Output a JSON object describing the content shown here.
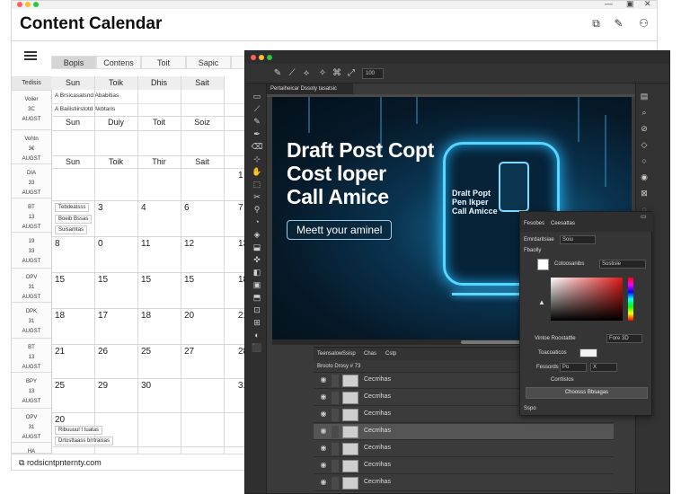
{
  "calendar_window": {
    "title": "Content Calendar",
    "tabs": [
      {
        "label": "Bopis"
      },
      {
        "label": "Contens"
      },
      {
        "label": "Toit"
      },
      {
        "label": "Sapic"
      }
    ],
    "sidebar_header": "Tedisis",
    "sidebar_cells": [
      {
        "line1": "Voiier",
        "line2": "3C",
        "line3": "AUGST"
      },
      {
        "line1": "Vohtn",
        "line2": "3€",
        "line3": "AUGST"
      },
      {
        "line1": "DIA",
        "line2": "33",
        "line3": "AUGST"
      },
      {
        "line1": "BT",
        "line2": "13",
        "line3": "AUGST"
      },
      {
        "line1": "19",
        "line2": "33",
        "line3": "AUGST"
      },
      {
        "line1": "OPV",
        "line2": "31",
        "line3": "AUGST"
      },
      {
        "line1": "DPK",
        "line2": "31",
        "line3": "AUGST"
      },
      {
        "line1": "BT",
        "line2": "13",
        "line3": "AUGST"
      },
      {
        "line1": "BPY",
        "line2": "13",
        "line3": "AUGST"
      },
      {
        "line1": "OPV",
        "line2": "31",
        "line3": "AUGST"
      },
      {
        "line1": "HA",
        "line2": "",
        "line3": ""
      }
    ],
    "day_headers_1": [
      "Sun",
      "Toik",
      "Dhis",
      "Sait"
    ],
    "notes": [
      "Brsicasatsnd Ababitias",
      "Bailistiirstotd Akbtaris"
    ],
    "day_headers_2": [
      "Sun",
      "Duiy",
      "Toit",
      "Soiz"
    ],
    "day_headers_3": [
      "Sun",
      "Toik",
      "Thir",
      "Sait"
    ],
    "week_rows": [
      [
        "",
        "",
        "",
        "",
        "1"
      ],
      [
        "",
        "3",
        "4",
        "6",
        "7"
      ],
      [
        "8",
        "0",
        "11",
        "12",
        "13"
      ],
      [
        "15",
        "15",
        "15",
        "15",
        "18"
      ],
      [
        "18",
        "17",
        "18",
        "20",
        "21"
      ],
      [
        "21",
        "26",
        "25",
        "27",
        "28"
      ],
      [
        "25",
        "29",
        "30",
        "",
        "31"
      ],
      [
        "20",
        "",
        "",
        "",
        ""
      ]
    ],
    "chips": [
      "Tebdeatsss",
      "Boeib Bssas",
      "Suisamtas",
      "Ribuuuul I tuatas",
      "Drtosttaass brrtraisas"
    ],
    "footer_link": "rodsicntpnternty.com"
  },
  "editor_window": {
    "doc_tab": "Pertaiheicar Dssoty tasatsic",
    "option_field": "100",
    "canvas": {
      "headline": "Draft Post Copt\nCost loper\nCall Amice",
      "cta": "Meett your aminel",
      "inner_text": "Dralt Popt\nPen lkper\nCall Amicce"
    },
    "layers": {
      "tabs": [
        "Teensalow",
        "Ssisp",
        "Chas",
        "Cstp"
      ],
      "controls": "Brooto  Drosy  # 73",
      "rows": [
        "Cecrrihas",
        "Cecrrihas",
        "Cecrrihas",
        "Cecrrihas",
        "Cecrrihas",
        "Cecrrihas",
        "Cecrrihas"
      ]
    },
    "picker": {
      "tabs": [
        "Fesobes",
        "Ceesattas"
      ],
      "row1": "Emrdaritsiae",
      "row1_field": "Soiu",
      "row2": "Fbaolly",
      "color_name": "Cotoosanibs",
      "color_field": "Sostisle",
      "mode_label": "Vintoe",
      "mode_value": "Roostattle",
      "mode_field": "Fore 3D",
      "trans_label": "Toacoaticos",
      "pass_label": "Fessords",
      "pass_field1": "Po",
      "pass_field2": "X",
      "check_label": "Corrtistos",
      "ok_button": "Choosss Bbsagas",
      "footer": "Sspo"
    },
    "colors": {
      "accent": "#57d6ff",
      "panel_bg": "#3a3a3a"
    }
  }
}
